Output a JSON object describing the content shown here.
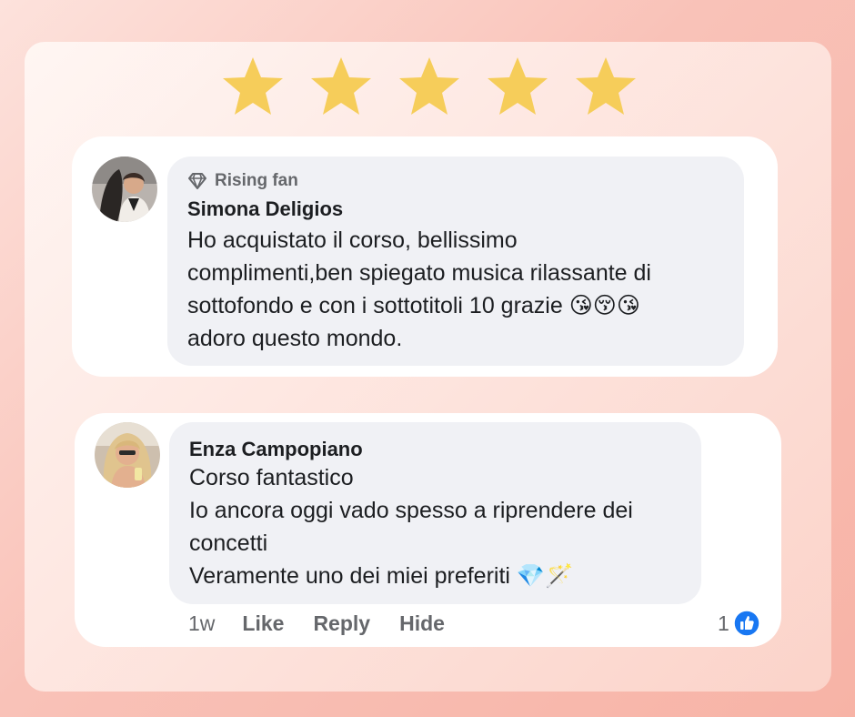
{
  "rating": {
    "stars": 5,
    "max": 5,
    "star_color": "#f6cd5a"
  },
  "comments": [
    {
      "badge_icon": "diamond-badge-icon",
      "badge": "Rising fan",
      "author": "Simona Deligios",
      "lines": [
        "Ho acquistato il corso, bellissimo",
        "complimenti,ben spiegato musica rilassante di",
        "sottofondo e con i sottotitoli 10 grazie 😘😚😘",
        "adoro questo mondo."
      ]
    },
    {
      "author": "Enza Campopiano",
      "lines": [
        "Corso fantastico",
        "Io ancora oggi vado spesso a riprendere dei",
        "concetti",
        "Veramente uno dei miei preferiti 💎🪄"
      ],
      "time": "1w",
      "actions": {
        "like": "Like",
        "reply": "Reply",
        "hide": "Hide"
      },
      "reaction_count": "1",
      "reaction_icon": "thumbs-up-icon",
      "reaction_color": "#1877f2"
    }
  ],
  "colors": {
    "bubble": "#f0f1f5",
    "meta_text": "#65676b",
    "body_text": "#1c1e21"
  }
}
